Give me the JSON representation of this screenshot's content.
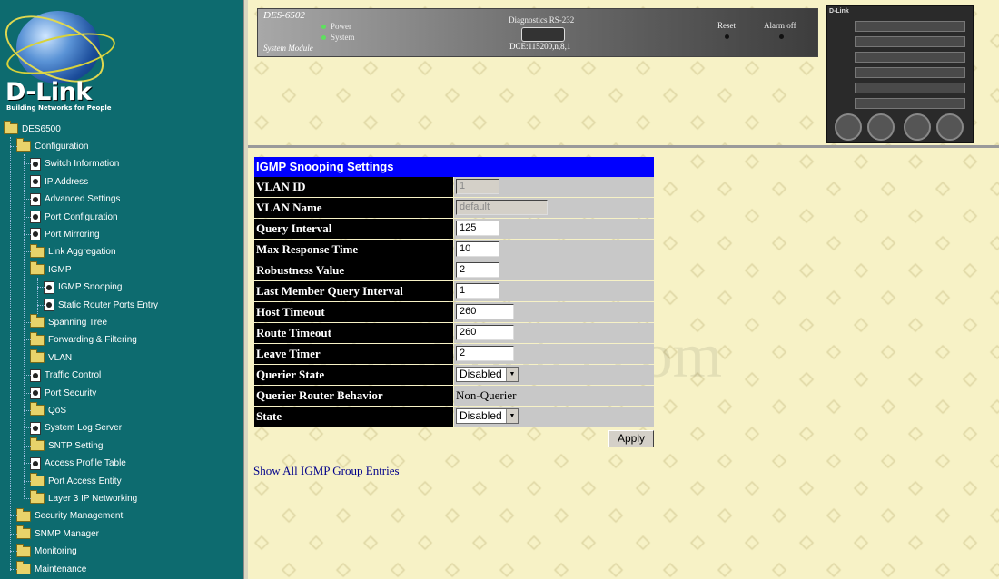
{
  "brand": {
    "name": "D-Link",
    "tagline": "Building Networks for People"
  },
  "tree": {
    "root": "DES6500",
    "items": [
      {
        "label": "Configuration",
        "icon": "folder-icon"
      },
      {
        "label": "Switch Information",
        "icon": "page-icon"
      },
      {
        "label": "IP Address",
        "icon": "page-icon"
      },
      {
        "label": "Advanced Settings",
        "icon": "page-icon"
      },
      {
        "label": "Port Configuration",
        "icon": "page-icon"
      },
      {
        "label": "Port Mirroring",
        "icon": "page-icon"
      },
      {
        "label": "Link Aggregation",
        "icon": "folder-icon"
      },
      {
        "label": "IGMP",
        "icon": "folder-icon"
      },
      {
        "label": "IGMP Snooping",
        "icon": "page-icon"
      },
      {
        "label": "Static Router Ports Entry",
        "icon": "page-icon"
      },
      {
        "label": "Spanning Tree",
        "icon": "folder-icon"
      },
      {
        "label": "Forwarding & Filtering",
        "icon": "folder-icon"
      },
      {
        "label": "VLAN",
        "icon": "folder-icon"
      },
      {
        "label": "Traffic Control",
        "icon": "page-icon"
      },
      {
        "label": "Port Security",
        "icon": "page-icon"
      },
      {
        "label": "QoS",
        "icon": "folder-icon"
      },
      {
        "label": "System Log Server",
        "icon": "page-icon"
      },
      {
        "label": "SNTP Setting",
        "icon": "folder-icon"
      },
      {
        "label": "Access Profile Table",
        "icon": "page-icon"
      },
      {
        "label": "Port Access Entity",
        "icon": "folder-icon"
      },
      {
        "label": "Layer 3 IP Networking",
        "icon": "folder-icon"
      },
      {
        "label": "Security Management",
        "icon": "folder-icon"
      },
      {
        "label": "SNMP Manager",
        "icon": "folder-icon"
      },
      {
        "label": "Monitoring",
        "icon": "folder-icon"
      },
      {
        "label": "Maintenance",
        "icon": "folder-icon"
      }
    ]
  },
  "device_panel": {
    "model": "DES-6502",
    "power_label": "Power",
    "system_label": "System",
    "module_label": "System Module",
    "diagnostics_label": "Diagnostics RS-232",
    "dce_label": "DCE:115200,n,8,1",
    "reset_label": "Reset",
    "alarm_label": "Alarm off",
    "chassis_logo": "D-Link",
    "led_color": "#5ee05e"
  },
  "settings": {
    "title": "IGMP Snooping Settings",
    "rows": {
      "vlan_id": {
        "label": "VLAN ID",
        "value": "1"
      },
      "vlan_name": {
        "label": "VLAN Name",
        "value": "default"
      },
      "query_interval": {
        "label": "Query Interval",
        "value": "125"
      },
      "max_response_time": {
        "label": "Max Response Time",
        "value": "10"
      },
      "robustness_value": {
        "label": "Robustness Value",
        "value": "2"
      },
      "last_member_query_interval": {
        "label": "Last Member Query Interval",
        "value": "1"
      },
      "host_timeout": {
        "label": "Host Timeout",
        "value": "260"
      },
      "route_timeout": {
        "label": "Route Timeout",
        "value": "260"
      },
      "leave_timer": {
        "label": "Leave Timer",
        "value": "2"
      },
      "querier_state": {
        "label": "Querier State",
        "value": "Disabled"
      },
      "querier_router_behavior": {
        "label": "Querier Router Behavior",
        "value": "Non-Querier"
      },
      "state": {
        "label": "State",
        "value": "Disabled"
      }
    },
    "apply_label": "Apply",
    "show_all_link": "Show All IGMP Group Entries",
    "title_bar_color": "#0000ff"
  },
  "watermark": "SetupRouter.com"
}
